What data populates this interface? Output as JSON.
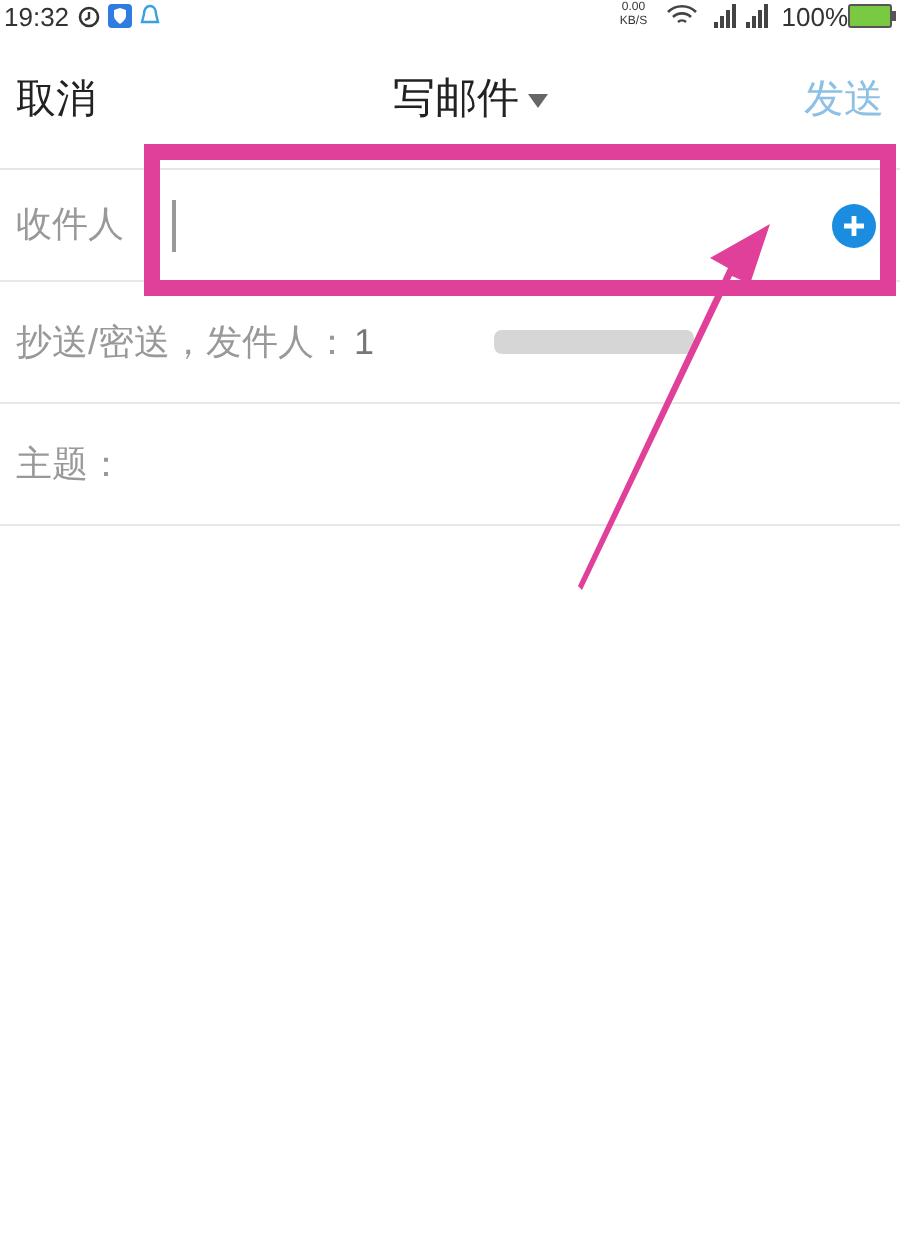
{
  "status_bar": {
    "time": "19:32",
    "net_speed": "0.00 KB/S",
    "battery": "100%"
  },
  "header": {
    "cancel": "取消",
    "title": "写邮件",
    "send": {
      "label": "发送",
      "disabled": true
    }
  },
  "fields": [
    {
      "kind": "recipient",
      "label": "收件人"
    },
    {
      "kind": "cc",
      "label": "抄送/密送，发件人：",
      "value": "1"
    },
    {
      "kind": "subject",
      "label": "主题："
    }
  ]
}
